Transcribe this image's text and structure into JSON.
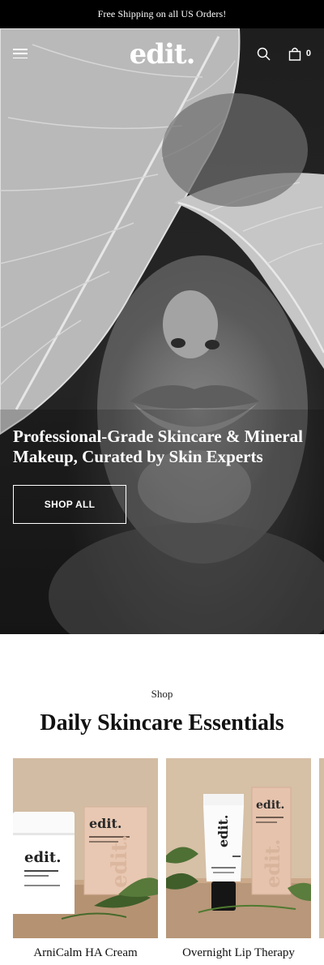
{
  "announcement": {
    "text": "Free Shipping on all US Orders!"
  },
  "header": {
    "logo": "edit.",
    "cart_count": "0",
    "icons": [
      "menu-icon",
      "search-icon",
      "shopping-bag-icon"
    ]
  },
  "hero": {
    "heading": "Professional-Grade Skincare & Mineral Makeup, Curated by Skin Experts",
    "cta_label": "SHOP ALL"
  },
  "section": {
    "eyebrow": "Shop",
    "title": "Daily Skincare Essentials"
  },
  "products": [
    {
      "name": "ArniCalm HA Cream",
      "package_brand": "edit.",
      "tube_brand": "edit."
    },
    {
      "name": "Overnight Lip Therapy",
      "package_brand": "edit.",
      "tube_brand": "edit."
    }
  ],
  "colors": {
    "announcement_bg": "#000000",
    "hero_text": "#ffffff",
    "product_bg": "#cdb79e",
    "package_pink": "#e6c3ac"
  }
}
